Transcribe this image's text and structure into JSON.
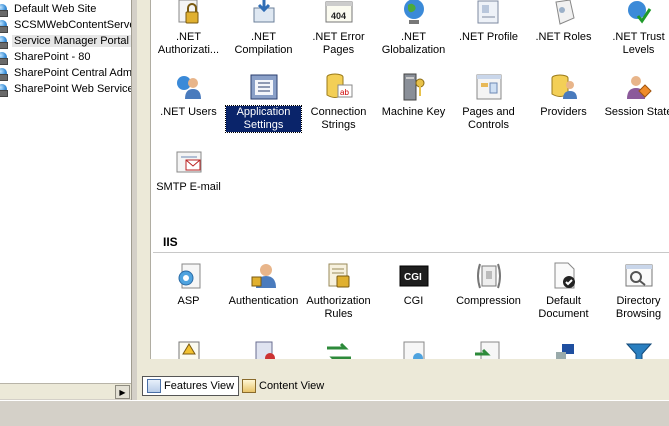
{
  "tree": {
    "items": [
      {
        "label": "Default Web Site",
        "icon": "site-icon"
      },
      {
        "label": "SCSMWebContentServer",
        "icon": "site-icon"
      },
      {
        "label": "Service Manager Portal",
        "icon": "site-icon",
        "selected": true
      },
      {
        "label": "SharePoint - 80",
        "icon": "site-icon"
      },
      {
        "label": "SharePoint Central Admin",
        "icon": "site-icon"
      },
      {
        "label": "SharePoint Web Services",
        "icon": "site-icon"
      }
    ],
    "scroll_right": "▶"
  },
  "aspnet": {
    "row1": [
      {
        "label": ".NET Authorizati...",
        "icon": "lock-user-icon"
      },
      {
        "label": ".NET Compilation",
        "icon": "compile-icon"
      },
      {
        "label": ".NET Error Pages",
        "icon": "error-page-icon"
      },
      {
        "label": ".NET Globalization",
        "icon": "globe-icon"
      },
      {
        "label": ".NET Profile",
        "icon": "profile-icon"
      },
      {
        "label": ".NET Roles",
        "icon": "roles-icon"
      },
      {
        "label": ".NET Trust Levels",
        "icon": "trust-icon"
      }
    ],
    "row2": [
      {
        "label": ".NET Users",
        "icon": "users-icon"
      },
      {
        "label": "Application Settings",
        "icon": "app-settings-icon",
        "selected": true
      },
      {
        "label": "Connection Strings",
        "icon": "connection-strings-icon"
      },
      {
        "label": "Machine Key",
        "icon": "machine-key-icon"
      },
      {
        "label": "Pages and Controls",
        "icon": "pages-controls-icon"
      },
      {
        "label": "Providers",
        "icon": "providers-icon"
      },
      {
        "label": "Session State",
        "icon": "session-state-icon"
      }
    ],
    "row3": [
      {
        "label": "SMTP E-mail",
        "icon": "smtp-icon"
      }
    ]
  },
  "iis": {
    "title": "IIS",
    "row1": [
      {
        "label": "ASP",
        "icon": "asp-icon"
      },
      {
        "label": "Authentication",
        "icon": "authentication-icon"
      },
      {
        "label": "Authorization Rules",
        "icon": "authorization-rules-icon"
      },
      {
        "label": "CGI",
        "icon": "cgi-icon"
      },
      {
        "label": "Compression",
        "icon": "compression-icon"
      },
      {
        "label": "Default Document",
        "icon": "default-document-icon"
      },
      {
        "label": "Directory Browsing",
        "icon": "directory-browsing-icon"
      }
    ]
  },
  "viewbar": {
    "features_label": "Features View",
    "content_label": "Content View"
  },
  "colors": {
    "selection": "#0a246a",
    "panel": "#ece9d8"
  }
}
